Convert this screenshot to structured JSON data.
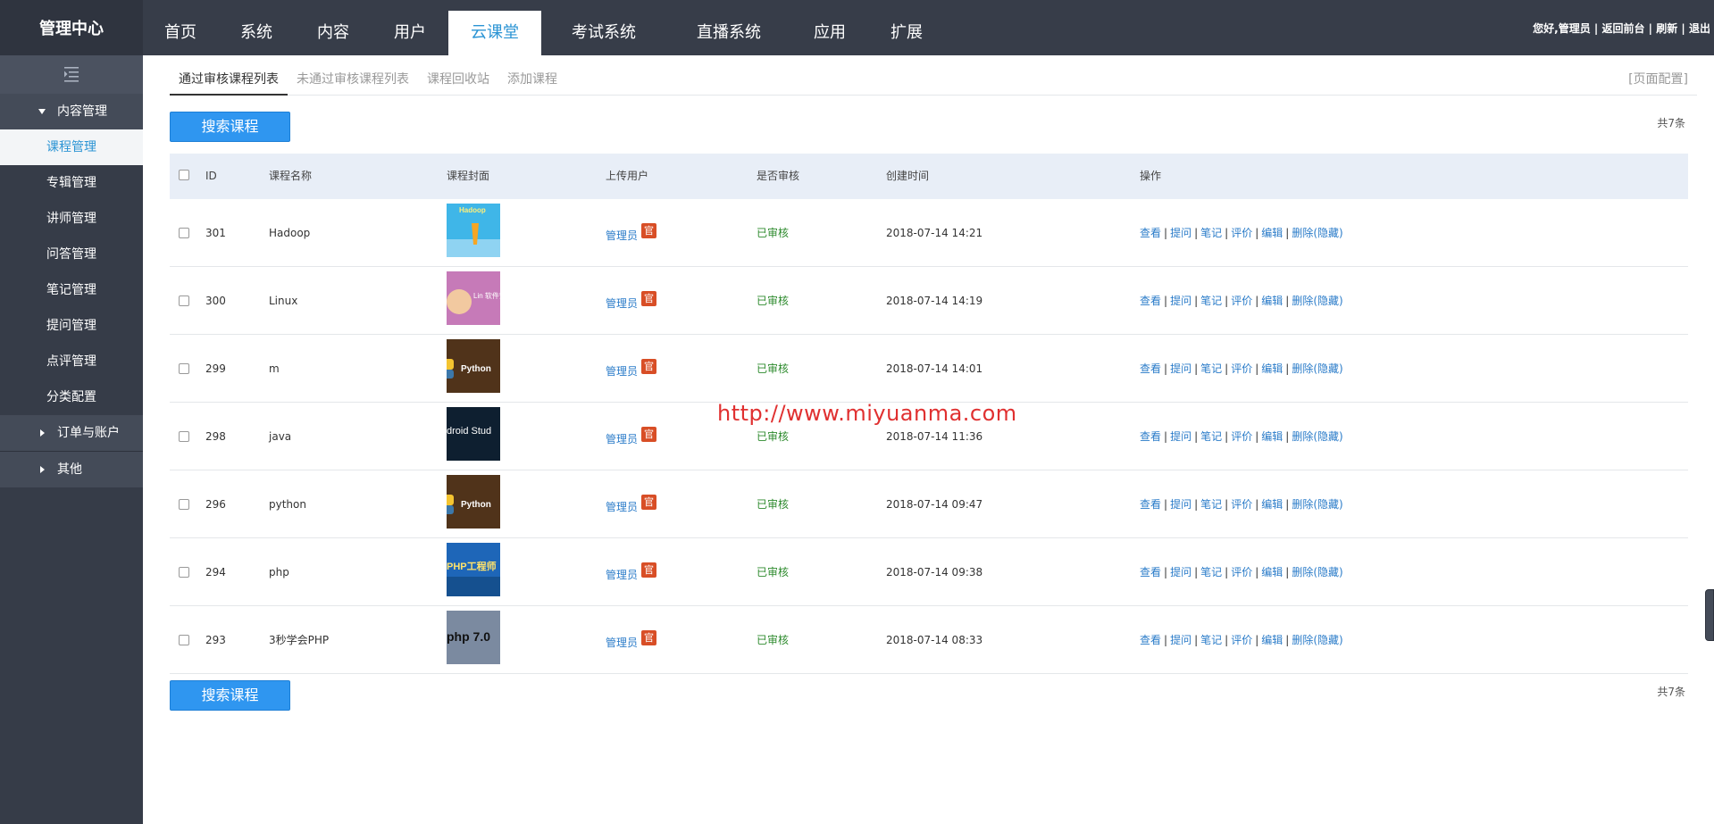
{
  "brand": "管理中心",
  "topnav": [
    {
      "label": "首页"
    },
    {
      "label": "系统"
    },
    {
      "label": "内容"
    },
    {
      "label": "用户"
    },
    {
      "label": "云课堂",
      "active": true
    },
    {
      "label": "考试系统"
    },
    {
      "label": "直播系统"
    },
    {
      "label": "应用"
    },
    {
      "label": "扩展"
    }
  ],
  "userinfo": {
    "greeting": "您好,管理员",
    "sep": " | ",
    "back": "返回前台",
    "refresh": "刷新",
    "logout": "退出"
  },
  "sidebar": {
    "toggle_icon": "menu-collapse-icon",
    "groups": [
      {
        "label": "内容管理",
        "expanded": true
      },
      {
        "label": "订单与账户",
        "expanded": false
      },
      {
        "label": "其他",
        "expanded": false
      }
    ],
    "items": [
      {
        "label": "课程管理",
        "active": true
      },
      {
        "label": "专辑管理"
      },
      {
        "label": "讲师管理"
      },
      {
        "label": "问答管理"
      },
      {
        "label": "笔记管理"
      },
      {
        "label": "提问管理"
      },
      {
        "label": "点评管理"
      },
      {
        "label": "分类配置"
      }
    ]
  },
  "subtabs": [
    {
      "label": "通过审核课程列表",
      "active": true
    },
    {
      "label": "未通过审核课程列表"
    },
    {
      "label": "课程回收站"
    },
    {
      "label": "添加课程"
    }
  ],
  "page_config": "[页面配置]",
  "search_button": "搜索课程",
  "total": "共7条",
  "table": {
    "headers": [
      "ID",
      "课程名称",
      "课程封面",
      "上传用户",
      "是否审核",
      "创建时间",
      "操作"
    ],
    "uploader": "管理员",
    "badge": "官",
    "status": "已审核",
    "ops": [
      "查看",
      "提问",
      "笔记",
      "评价",
      "编辑",
      "删除(隐藏)"
    ],
    "op_sep": "|",
    "rows": [
      {
        "id": "301",
        "name": "Hadoop",
        "created": "2018-07-14 14:21",
        "cover": {
          "style": "hadoop",
          "text": "Hadoop",
          "bg": "#3fb6e8"
        }
      },
      {
        "id": "300",
        "name": "Linux",
        "created": "2018-07-14 14:19",
        "cover": {
          "style": "linux",
          "text": "Lin 软件安",
          "bg": "#c67ab8"
        }
      },
      {
        "id": "299",
        "name": "m",
        "created": "2018-07-14 14:01",
        "cover": {
          "style": "python",
          "text": "Python",
          "bg": "#5a3a1e"
        }
      },
      {
        "id": "298",
        "name": "java",
        "created": "2018-07-14 11:36",
        "cover": {
          "style": "android",
          "text": "droid Stud",
          "bg": "#0e1f30"
        }
      },
      {
        "id": "296",
        "name": "python",
        "created": "2018-07-14 09:47",
        "cover": {
          "style": "python",
          "text": "Python",
          "bg": "#5a3a1e"
        }
      },
      {
        "id": "294",
        "name": "php",
        "created": "2018-07-14 09:38",
        "cover": {
          "style": "php",
          "text": "PHP工程师",
          "bg": "#1e66b8"
        }
      },
      {
        "id": "293",
        "name": "3秒学会PHP",
        "created": "2018-07-14 08:33",
        "cover": {
          "style": "php7",
          "text": "php 7.0",
          "bg": "#7b8aa0"
        }
      }
    ]
  },
  "watermark": "http://www.miyuanma.com",
  "colors": {
    "topbar": "#373d49",
    "accent": "#2b94d4",
    "button": "#2f96f0",
    "link": "#2b7cc9",
    "status": "#2e8b2e",
    "badge": "#d84e26"
  }
}
